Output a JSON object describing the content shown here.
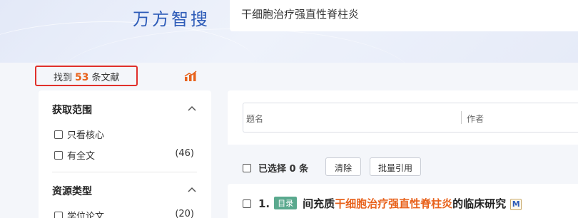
{
  "header": {
    "logo_text": "万方智搜",
    "search_value": "干细胞治疗强直性脊柱炎"
  },
  "summary": {
    "prefix": "找到",
    "count": "53",
    "suffix": "条文献"
  },
  "sidebar": {
    "sections": [
      {
        "title": "获取范围",
        "items": [
          {
            "label": "只看核心",
            "count": ""
          },
          {
            "label": "有全文",
            "count": "(46)"
          }
        ]
      },
      {
        "title": "资源类型",
        "items": [
          {
            "label": "学位论文",
            "count": "(20)"
          }
        ]
      }
    ]
  },
  "search_fields": {
    "title_label": "题名",
    "author_label": "作者"
  },
  "toolbar": {
    "selected_text": "已选择 0 条",
    "clear_label": "清除",
    "cite_label": "批量引用"
  },
  "results": [
    {
      "index": "1.",
      "tag": "目录",
      "title_before": "间充质",
      "title_highlight": "干细胞治疗强直性脊柱炎",
      "title_after": "的临床研究",
      "badge": "M"
    }
  ],
  "colors": {
    "brand": "#2e5cb8",
    "highlight": "#e8621c",
    "tag_green": "#5aa98e",
    "count_border": "#e0302b"
  },
  "icons": {
    "chart": "bar-chart-icon",
    "collapse": "chevron-up-icon",
    "badge": "m-icon"
  }
}
